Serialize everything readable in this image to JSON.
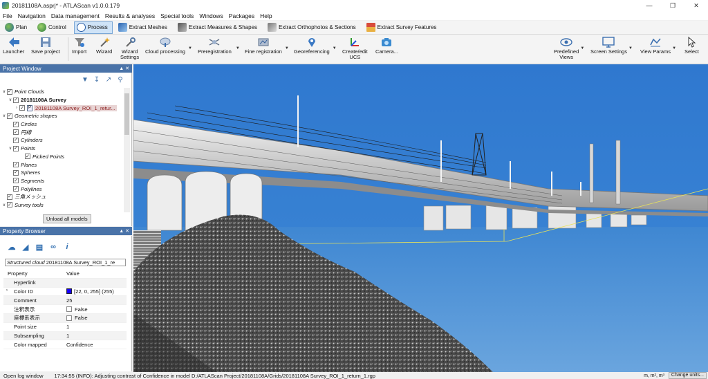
{
  "window": {
    "title": "20181108A.asprj* - ATLAScan v1.0.0.179"
  },
  "menu": [
    "File",
    "Navigation",
    "Data management",
    "Results & analyses",
    "Special tools",
    "Windows",
    "Packages",
    "Help"
  ],
  "modes": {
    "plan": "Plan",
    "control": "Control",
    "process": "Process",
    "extract_meshes": "Extract Meshes",
    "extract_measures": "Extract Measures & Shapes",
    "extract_ortho": "Extract Orthophotos & Sections",
    "extract_survey": "Extract Survey Features"
  },
  "ribbon": {
    "launcher": "Launcher",
    "save_project": "Save project",
    "import": "Import",
    "wizard": "Wizard",
    "wizard_settings_1": "Wizard",
    "wizard_settings_2": "Settings",
    "cloud_processing": "Cloud processing",
    "preregistration": "Preregistration",
    "fine_registration": "Fine registration",
    "georeferencing": "Georeferencing",
    "create_ucs_1": "Create/edit",
    "create_ucs_2": "UCS",
    "camera": "Camera...",
    "predefined_views_1": "Predefined",
    "predefined_views_2": "Views",
    "screen_settings": "Screen Settings",
    "view_params": "View Params",
    "select": "Select"
  },
  "project_window": {
    "title": "Project Window",
    "tree": {
      "point_clouds": "Point Clouds",
      "survey": "20181108A Survey",
      "survey_item": "20181108A Survey_ROI_1_retur...",
      "geometric_shapes": "Geometric shapes",
      "circles": "Circles",
      "circles_jp": "円線",
      "cylinders": "Cylinders",
      "points": "Points",
      "picked_points": "Picked Points",
      "planes": "Planes",
      "spheres": "Spheres",
      "segments": "Segments",
      "polylines": "Polylines",
      "mesh_jp": "三角メッシュ",
      "survey_tools": "Survey tools"
    },
    "unload_button": "Unload all models"
  },
  "property_browser": {
    "title": "Property Browser",
    "object_type": "Structured cloud",
    "object_name": "20181108A Survey_ROI_1_re",
    "headers": {
      "property": "Property",
      "value": "Value"
    },
    "rows": {
      "hyperlink": {
        "key": "Hyperlink",
        "value": ""
      },
      "color_id": {
        "key": "Color ID",
        "value": "[22, 0, 255] (255)"
      },
      "comment": {
        "key": "Comment",
        "value": "25"
      },
      "annot": {
        "key": "注釈表示",
        "value": "False"
      },
      "coord": {
        "key": "座標系表示",
        "value": "False"
      },
      "point_size": {
        "key": "Point size",
        "value": "1"
      },
      "subsampling": {
        "key": "Subsampling",
        "value": "1"
      },
      "color_mapped": {
        "key": "Color mapped",
        "value": "Confidence"
      }
    }
  },
  "status": {
    "open_log": "Open log window",
    "message": "17:34:55 (INFO): Adjusting contrast of Confidence in model D:/ATLAScan Project/20181108A/Grids/20181108A Survey_ROI_1_return_1.rgp",
    "units": "m, m², m³",
    "change_units": "Change units..."
  },
  "colors": {
    "accent": "#4a73a8",
    "sky": "#3a84d4",
    "color_id_swatch": "#1600ff"
  }
}
